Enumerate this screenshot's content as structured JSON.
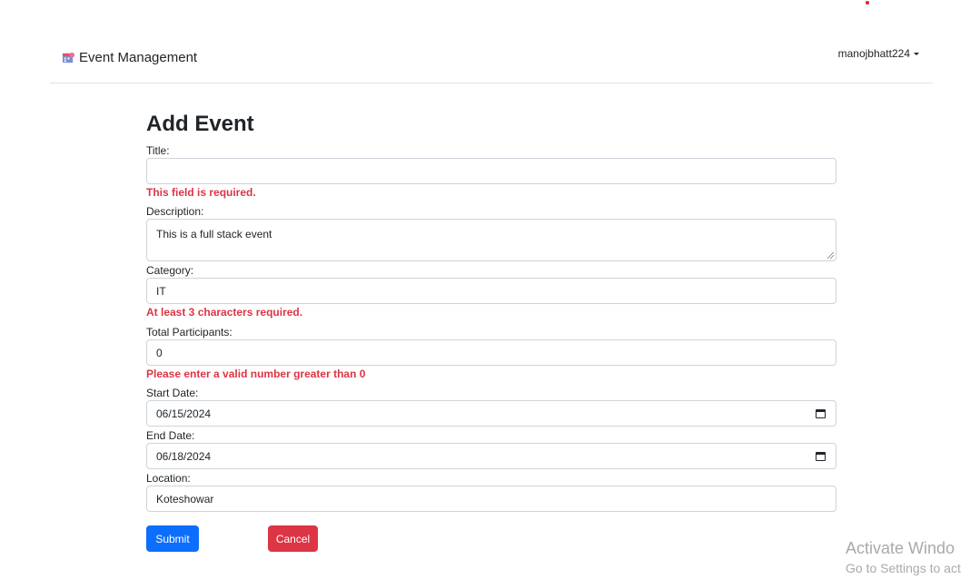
{
  "navbar": {
    "brand": "Event Management",
    "username": "manojbhatt224"
  },
  "form": {
    "title": "Add Event",
    "fields": {
      "title": {
        "label": "Title:",
        "value": "",
        "error": "This field is required."
      },
      "description": {
        "label": "Description:",
        "value": "This is a full stack event"
      },
      "category": {
        "label": "Category:",
        "value": "IT",
        "error": "At least 3 characters required."
      },
      "participants": {
        "label": "Total Participants:",
        "value": "0",
        "error": "Please enter a valid number greater than 0"
      },
      "start_date": {
        "label": "Start Date:",
        "value": "06/15/2024"
      },
      "end_date": {
        "label": "End Date:",
        "value": "06/18/2024"
      },
      "location": {
        "label": "Location:",
        "value": "Koteshowar"
      }
    },
    "submit_label": "Submit",
    "cancel_label": "Cancel"
  },
  "watermark": {
    "title": "Activate Windo",
    "subtitle": "Go to Settings to act"
  },
  "colors": {
    "primary": "#0d6efd",
    "danger": "#dc3545",
    "border": "#ced4da"
  }
}
